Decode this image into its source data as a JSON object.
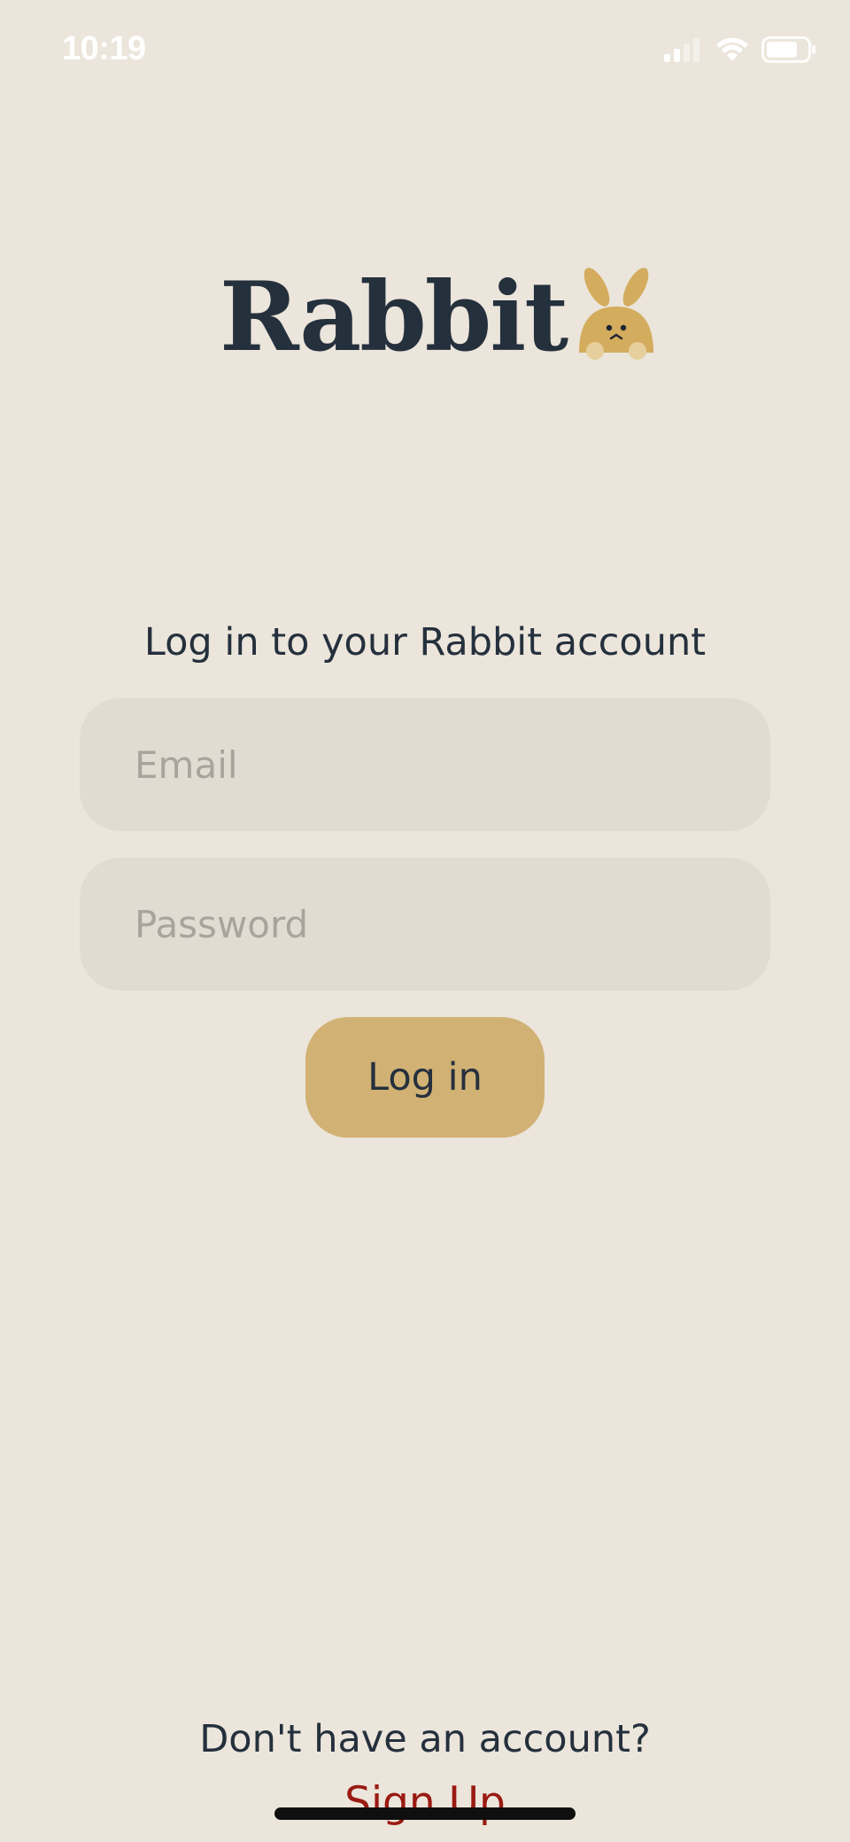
{
  "status_bar": {
    "time": "10:19",
    "icons": [
      "cellular-signal-icon",
      "wifi-icon",
      "battery-icon"
    ]
  },
  "logo": {
    "text": "Rabbit",
    "icon": "bunny-icon"
  },
  "login": {
    "title": "Log in to your Rabbit account",
    "email_placeholder": "Email",
    "email_value": "",
    "password_placeholder": "Password",
    "password_value": "",
    "button_label": "Log in"
  },
  "signup": {
    "prompt": "Don't have an account?",
    "link_label": "Sign Up"
  },
  "colors": {
    "background": "#ebe5db",
    "field": "#e2dbd1",
    "accent": "#d1b174",
    "text": "#25303d",
    "link": "#9a1a12"
  }
}
